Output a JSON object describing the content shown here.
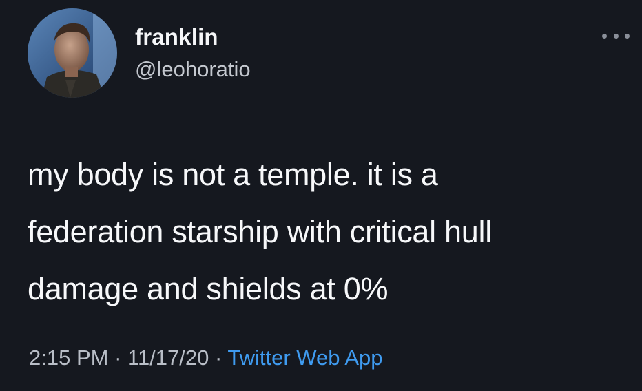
{
  "tweet": {
    "display_name": "franklin",
    "handle": "@leohoratio",
    "text_lines": [
      "my body is not a temple. it is a",
      "federation starship with critical hull",
      "damage and shields at 0%"
    ],
    "time": "2:15 PM",
    "date": "11/17/20",
    "separator": " · ",
    "source": "Twitter Web App",
    "more_icon": "more-options-icon"
  },
  "colors": {
    "background": "#15181f",
    "link": "#3f9bf0"
  }
}
